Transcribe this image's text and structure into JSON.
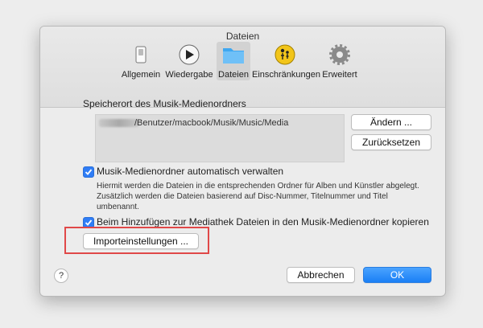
{
  "window": {
    "title": "Dateien"
  },
  "tabs": [
    {
      "label": "Allgemein",
      "icon": "switch-icon"
    },
    {
      "label": "Wiedergabe",
      "icon": "play-icon"
    },
    {
      "label": "Dateien",
      "icon": "folder-icon",
      "selected": true
    },
    {
      "label": "Einschränkungen",
      "icon": "parental-restriction-icon"
    },
    {
      "label": "Erweitert",
      "icon": "gear-icon"
    }
  ],
  "storage": {
    "heading": "Speicherort des Musik-Medienordners",
    "path": "/Benutzer/macbook/Musik/Music/Media",
    "change_button": "Ändern ...",
    "reset_button": "Zurücksetzen"
  },
  "manage": {
    "label": "Musik-Medienordner automatisch verwalten",
    "checked": true,
    "description": "Hiermit werden die Dateien in die entsprechenden Ordner für Alben und Künstler abgelegt. Zusätzlich werden die Dateien basierend auf Disc-Nummer, Titelnummer und Titel umbenannt."
  },
  "copy": {
    "label": "Beim Hinzufügen zur Mediathek Dateien in den Musik-Medienordner kopieren",
    "checked": true
  },
  "import_button": "Importeinstellungen ...",
  "footer": {
    "help": "?",
    "cancel_button": "Abbrechen",
    "ok_button": "OK"
  },
  "colors": {
    "accent": "#2f7df6",
    "highlight": "#e04848"
  }
}
